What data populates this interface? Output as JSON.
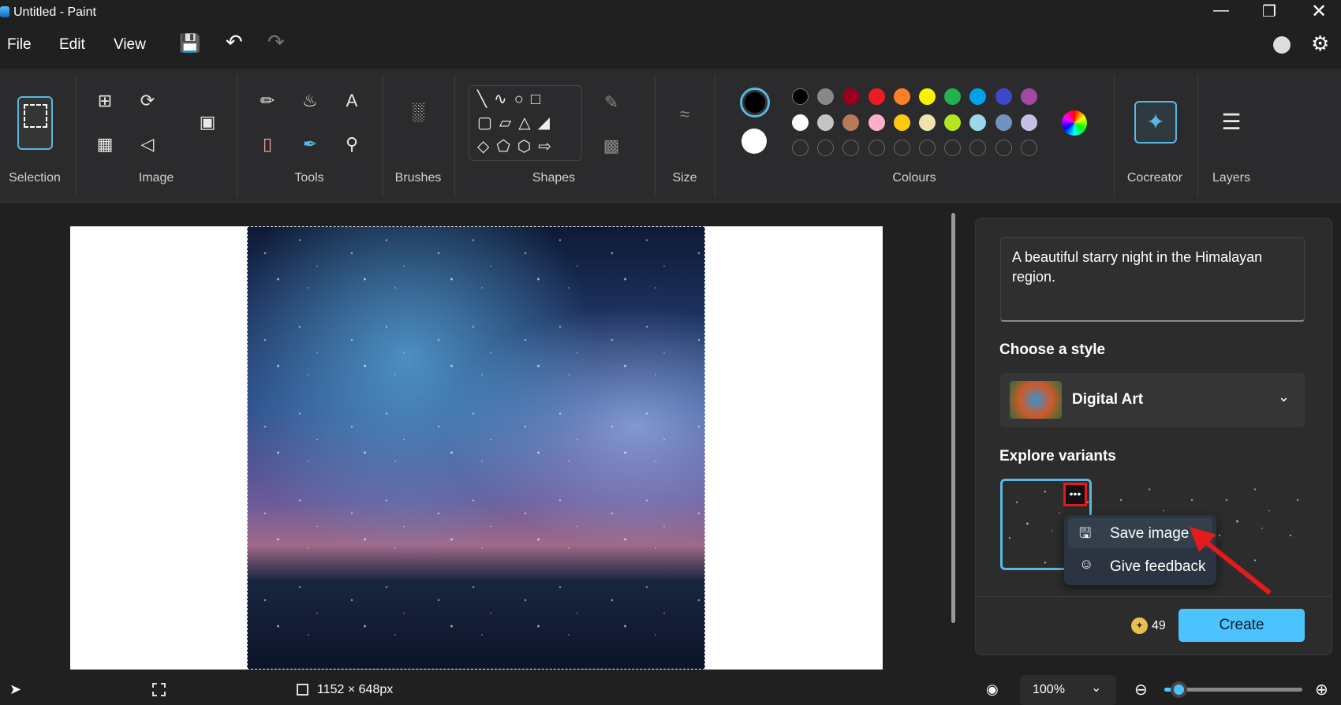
{
  "window": {
    "title": "Untitled - Paint"
  },
  "menu": {
    "file": "File",
    "edit": "Edit",
    "view": "View"
  },
  "ribbon": {
    "groups": [
      "Selection",
      "Image",
      "Tools",
      "Brushes",
      "Shapes",
      "Size",
      "Colours",
      "Cocreator",
      "Layers"
    ]
  },
  "colours": {
    "primary": "#000000",
    "secondary": "#ffffff",
    "row1": [
      "#000000",
      "#888888",
      "#990020",
      "#ed1c24",
      "#ff7f27",
      "#fff200",
      "#22b14c",
      "#00a2e8",
      "#3f48cc",
      "#a349a4"
    ],
    "row2": [
      "#ffffff",
      "#c3c3c3",
      "#b97a57",
      "#ffaec9",
      "#ffc90e",
      "#efe4b0",
      "#b5e61d",
      "#99d9ea",
      "#7092be",
      "#c8bfe7"
    ]
  },
  "cocreator": {
    "prompt": "A beautiful starry night in the Himalayan region.",
    "style_heading": "Choose a style",
    "style_value": "Digital Art",
    "variants_heading": "Explore variants",
    "context_menu": [
      "Save image",
      "Give feedback"
    ],
    "credits": "49",
    "create_label": "Create"
  },
  "status": {
    "canvas_size": "1152 × 648px",
    "zoom": "100%",
    "zoom_fraction": 0.1
  }
}
